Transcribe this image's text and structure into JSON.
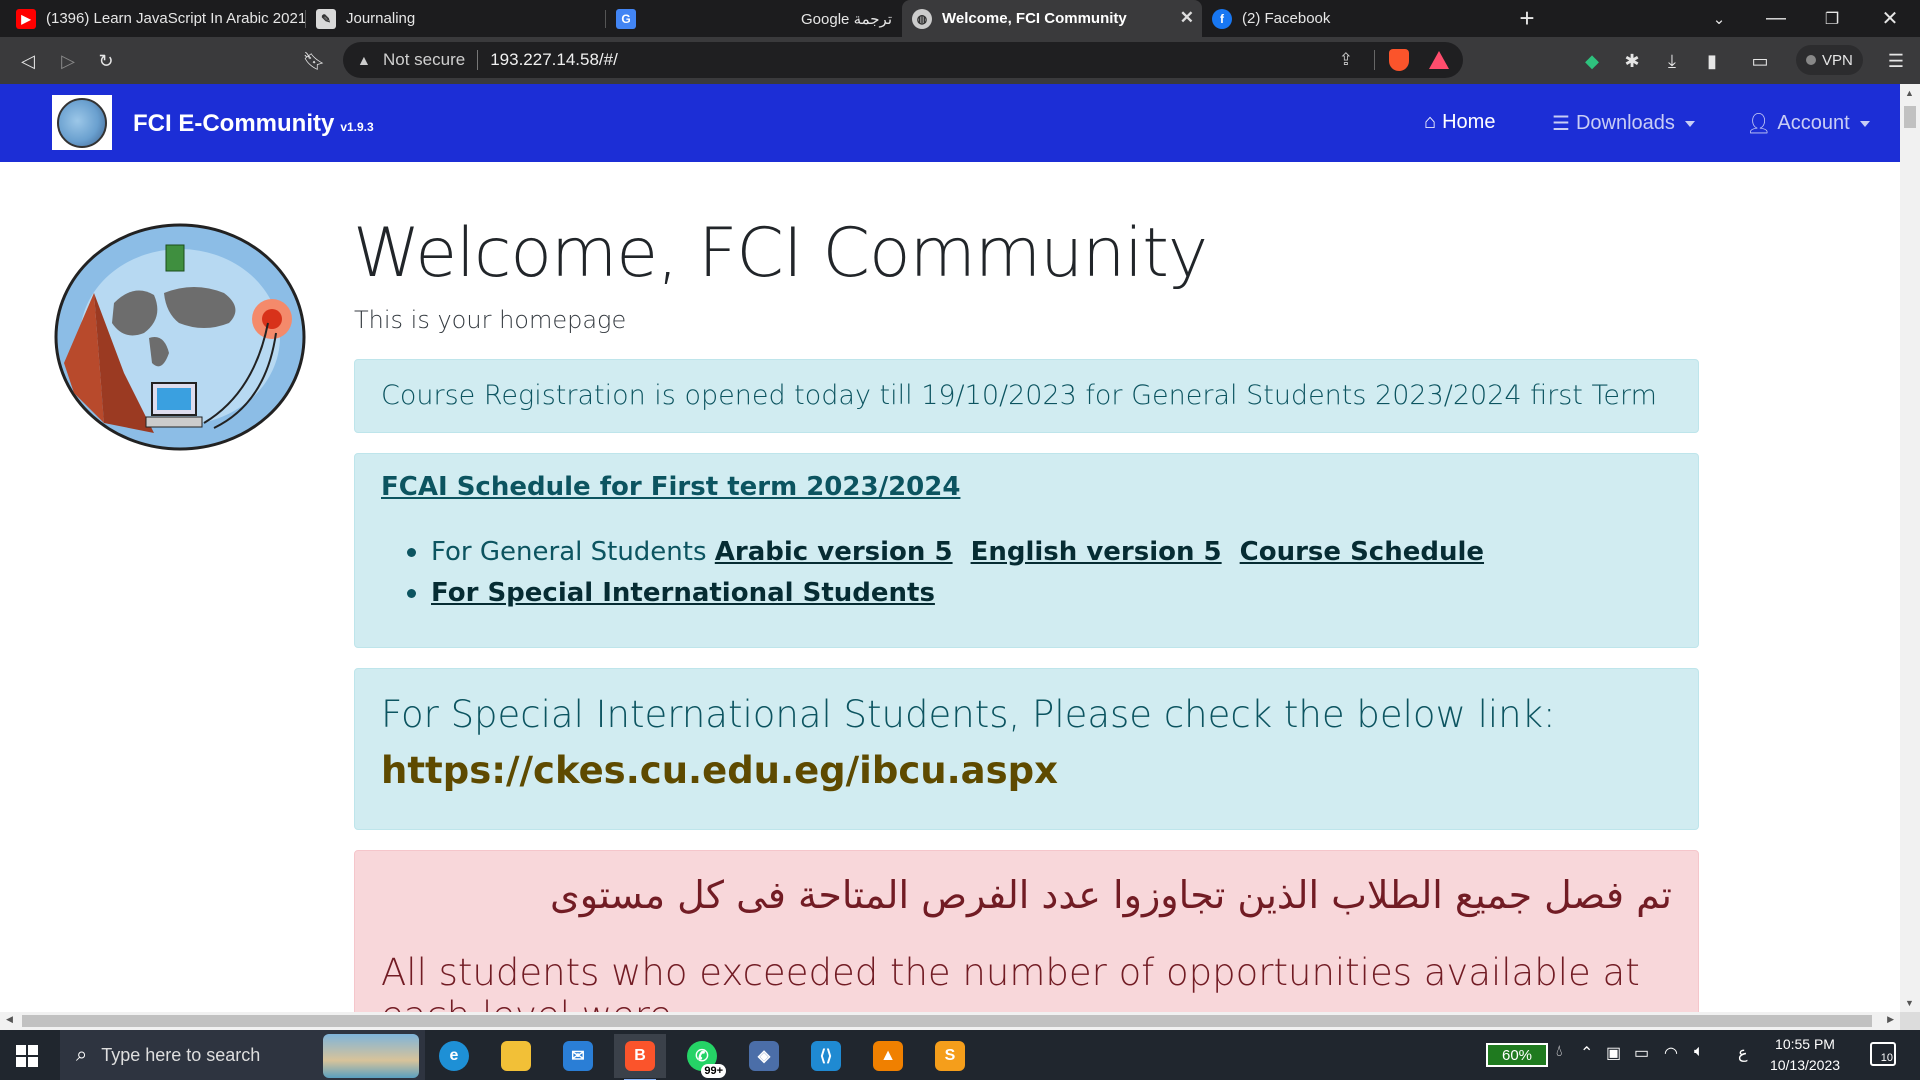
{
  "tabs": [
    {
      "title": "(1396) Learn JavaScript In Arabic 2021",
      "icon": "youtube-icon",
      "color": "#ff0000"
    },
    {
      "title": "Journaling",
      "icon": "journal-icon",
      "color": "#d9d9d9"
    },
    {
      "title": "Google ترجمة",
      "icon": "translate-icon",
      "color": "#4285f4"
    },
    {
      "title": "Welcome, FCI Community",
      "icon": "globe-icon",
      "color": "#cccccc",
      "active": true
    },
    {
      "title": "(2) Facebook",
      "icon": "facebook-icon",
      "color": "#1877f2"
    }
  ],
  "address": {
    "security": "Not secure",
    "url": "193.227.14.58/#/"
  },
  "toolbar": {
    "vpn_label": "VPN"
  },
  "navbar": {
    "brand": "FCI E-Community",
    "version": "v1.9.3",
    "home": "Home",
    "downloads": "Downloads",
    "account": "Account",
    "color": "#1c2ed6"
  },
  "page": {
    "title": "Welcome, FCI Community",
    "subtitle": "This is your homepage",
    "registration_notice": "Course Registration is opened today till 19/10/2023 for General Students 2023/2024 first Term",
    "schedule": {
      "title": "FCAI Schedule for First term 2023/2024",
      "general_prefix": "For General Students",
      "arabic_link": "Arabic version 5",
      "english_link": "English version 5",
      "course_link": "Course Schedule",
      "special_link": "For Special International Students"
    },
    "international": {
      "text": "For Special International Students, Please check the below link:",
      "link": "https://ckes.cu.edu.eg/ibcu.aspx"
    },
    "dismissal": {
      "arabic": "تم فصل جميع الطلاب الذين تجاوزوا عدد الفرص المتاحة فى كل مستوى",
      "english": "All students who exceeded the number of opportunities available at each level were"
    }
  },
  "taskbar": {
    "search_placeholder": "Type here to search",
    "whatsapp_badge": "99+",
    "battery": "60%",
    "lang": "ع",
    "time": "10:55 PM",
    "date": "10/13/2023",
    "notifications": "10"
  }
}
